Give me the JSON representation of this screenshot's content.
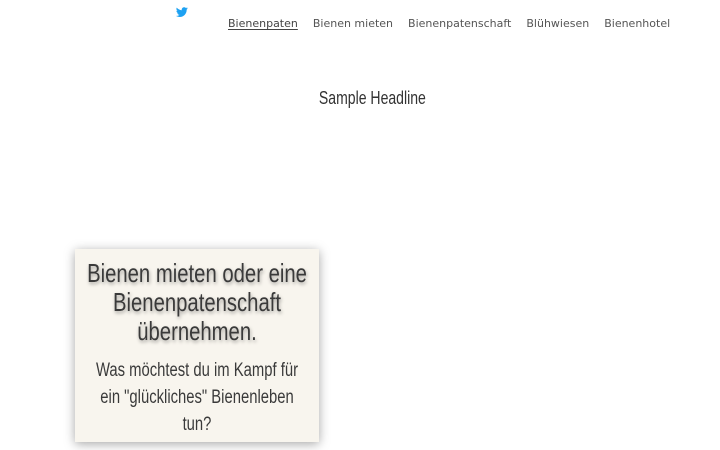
{
  "header": {
    "social": {
      "icon": "twitter-icon",
      "color": "#1da1f2"
    },
    "nav": {
      "items": [
        {
          "label": "Bienenpaten",
          "active": true
        },
        {
          "label": "Bienen mieten",
          "active": false
        },
        {
          "label": "Bienenpatenschaft",
          "active": false
        },
        {
          "label": "Blühwiesen",
          "active": false
        },
        {
          "label": "Bienenhotel",
          "active": false
        }
      ]
    }
  },
  "main": {
    "headline": "Sample Headline"
  },
  "card": {
    "title": "Bienen mieten oder eine Bienenpatenschaft übernehmen.",
    "subtitle": "Was möchtest du im Kampf für ein \"glückliches\" Bienenleben tun?",
    "background": "#f8f5ee"
  }
}
